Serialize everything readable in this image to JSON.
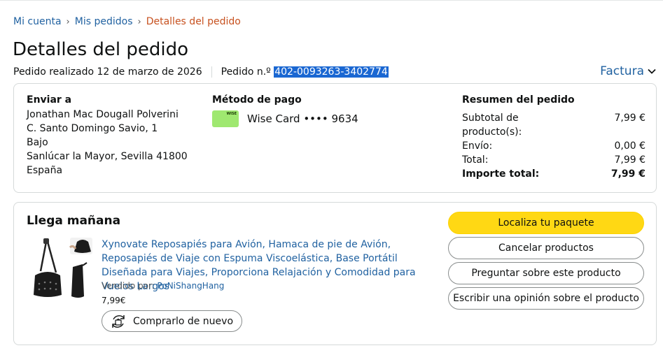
{
  "breadcrumb": {
    "item1": "Mi cuenta",
    "item2": "Mis pedidos",
    "current": "Detalles del pedido"
  },
  "page_title": "Detalles del pedido",
  "order": {
    "placed": "Pedido realizado 12 de marzo de 2026",
    "number_label": "Pedido n.º",
    "number": "402-0093263-3402774",
    "invoice_label": "Factura"
  },
  "shipping": {
    "title": "Enviar a",
    "lines": [
      "Jonathan Mac Dougall Polverini",
      "C. Santo Domingo Savio, 1",
      "Bajo",
      "Sanlúcar la Mayor, Sevilla 41800",
      "España"
    ]
  },
  "payment": {
    "title": "Método de pago",
    "card_brand": "WISE",
    "card_text": "Wise Card •••• 9634"
  },
  "summary": {
    "title": "Resumen del pedido",
    "rows": [
      {
        "label": "Subtotal de producto(s):",
        "value": "7,99 €"
      },
      {
        "label": "Envío:",
        "value": "0,00 €"
      },
      {
        "label": "Total:",
        "value": "7,99 €"
      },
      {
        "label": "Importe total:",
        "value": "7,99 €"
      }
    ]
  },
  "delivery": {
    "arrival": "Llega mañana",
    "product_title": "Xynovate Reposapiés para Avión, Hamaca de pie de Avión, Reposapiés de Viaje con Espuma Viscoelástica, Base Portátil Diseñada para Viajes, Proporciona Relajación y Comodidad para Vuelos Largos",
    "seller_label": "Vendido por:",
    "seller": "PoNiShangHang",
    "price": "7,99€",
    "rebuy_label": "Comprarlo de nuevo",
    "actions": [
      "Localiza tu paquete",
      "Cancelar productos",
      "Preguntar sobre este producto",
      "Escribir una opinión sobre el producto"
    ]
  },
  "colors": {
    "link": "#2162a1",
    "breadcrumb_current": "#c7511f",
    "primary_button": "#ffd814",
    "selection": "#1a67d2"
  }
}
